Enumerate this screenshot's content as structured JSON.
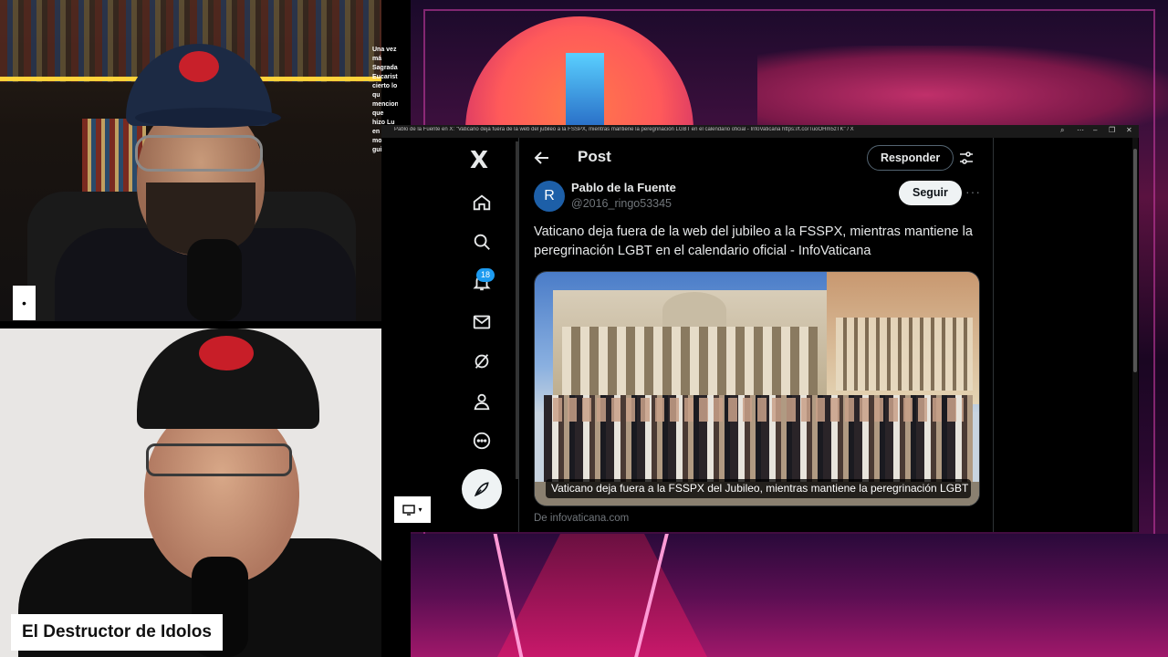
{
  "window": {
    "title": "Pablo de la Fuente en X: \"Vaticano deja fuera de la web del jubileo a la FSSPX, mientras mantiene la peregrinación LGBT en el calendario oficial - InfoVaticana https://t.co/TuoOHm5zTK\" / X"
  },
  "sidebar": {
    "logo": "X",
    "items": [
      {
        "name": "home",
        "icon": "home-icon"
      },
      {
        "name": "explore",
        "icon": "search-icon"
      },
      {
        "name": "notifications",
        "icon": "bell-icon",
        "badge": "18"
      },
      {
        "name": "messages",
        "icon": "mail-icon"
      },
      {
        "name": "grok",
        "icon": "grok-icon"
      },
      {
        "name": "profile",
        "icon": "person-icon"
      },
      {
        "name": "more",
        "icon": "more-circle-icon"
      }
    ],
    "compose_icon": "feather-icon"
  },
  "header": {
    "title": "Post",
    "reply_label": "Responder"
  },
  "post": {
    "author_name": "Pablo de la Fuente",
    "author_handle": "@2016_ringo53345",
    "avatar_letter": "R",
    "follow_label": "Seguir",
    "more_label": "···",
    "text": "Vaticano deja fuera de la web del jubileo a la FSSPX, mientras mantiene la peregrinación LGBT en el calendario oficial - InfoVaticana",
    "card": {
      "caption": "Vaticano deja fuera a la FSSPX del Jubileo, mientras mantiene la peregrinación LGBT e...",
      "source": "De infovaticana.com"
    }
  },
  "overlay": {
    "name_tag": "El Destructor de Idolos",
    "small_marker": "•",
    "chat_lines": [
      "Una vez má",
      "Sagrada",
      "Eucaristía,",
      "cierto lo qu",
      "menciona,",
      "que hizo Lu",
      "en su mom",
      "guiño."
    ]
  },
  "colors": {
    "accent": "#1d9bf0",
    "background": "#000000",
    "text": "#e7e9ea",
    "muted": "#71767b"
  }
}
